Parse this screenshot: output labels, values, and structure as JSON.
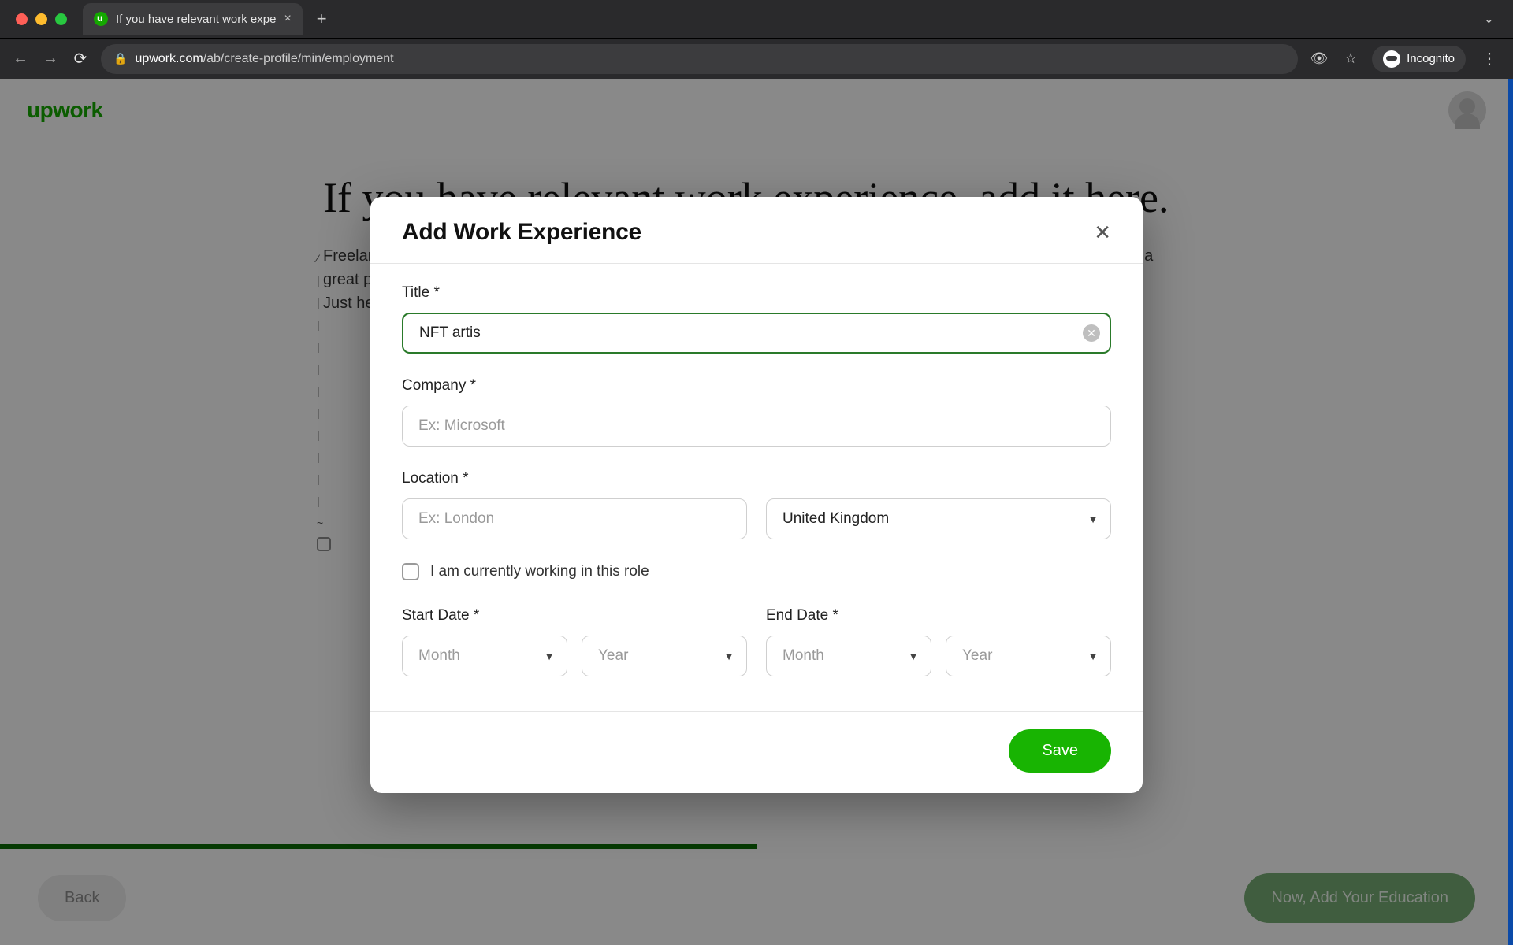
{
  "browser": {
    "tab_title": "If you have relevant work expe",
    "url_host": "upwork.com",
    "url_path": "/ab/create-profile/min/employment",
    "incognito_label": "Incognito"
  },
  "site": {
    "logo_text": "upwork"
  },
  "page": {
    "heading": "If you have relevant work experience, add it here.",
    "lead_a": "Freelancers who add their experience are twice as likely to win work. But if you're just starting out, you can still create a great profile.",
    "lead_b": "Just head on to the next page.",
    "back_label": "Back",
    "next_label": "Now, Add Your Education"
  },
  "modal": {
    "title": "Add Work Experience",
    "fields": {
      "title_label": "Title *",
      "title_value": "NFT artis",
      "company_label": "Company *",
      "company_placeholder": "Ex: Microsoft",
      "location_label": "Location *",
      "city_placeholder": "Ex: London",
      "country_value": "United Kingdom",
      "currently_label": "I am currently working in this role",
      "start_label": "Start Date *",
      "end_label": "End Date *",
      "month_placeholder": "Month",
      "year_placeholder": "Year"
    },
    "save_label": "Save"
  }
}
